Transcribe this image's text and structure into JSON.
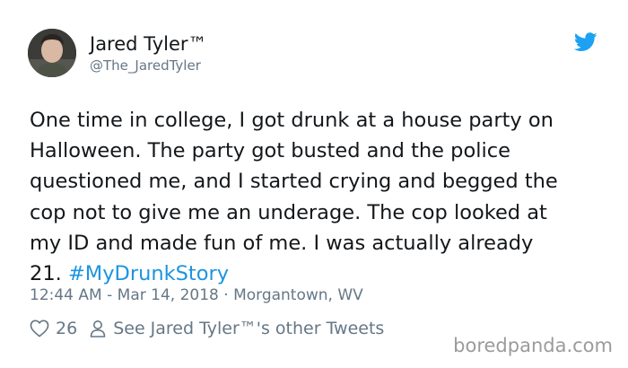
{
  "author": {
    "display_name": "Jared Tyler™",
    "handle": "@The_JaredTyler"
  },
  "tweet": {
    "text": "One time in college, I got drunk at a house party on\nHalloween. The party got busted and the police\nquestioned me, and I started crying and begged the\ncop not to give me an underage. The cop looked at\nmy ID and made fun of me. I was actually already\n21. ",
    "hashtag": "#MyDrunkStory",
    "time": "12:44 AM",
    "date": "Mar 14, 2018",
    "location": "Morgantown, WV"
  },
  "meta_separators": {
    "dash": " - ",
    "dot": " · "
  },
  "actions": {
    "like_count": "26",
    "other_tweets_label": "See Jared Tyler™'s other Tweets"
  },
  "watermark": "boredpanda.com",
  "colors": {
    "text": "#14171a",
    "secondary": "#657786",
    "link": "#1b95e0",
    "twitter_blue": "#1da1f2"
  },
  "icons": [
    "twitter-bird-icon",
    "heart-icon",
    "person-icon"
  ]
}
